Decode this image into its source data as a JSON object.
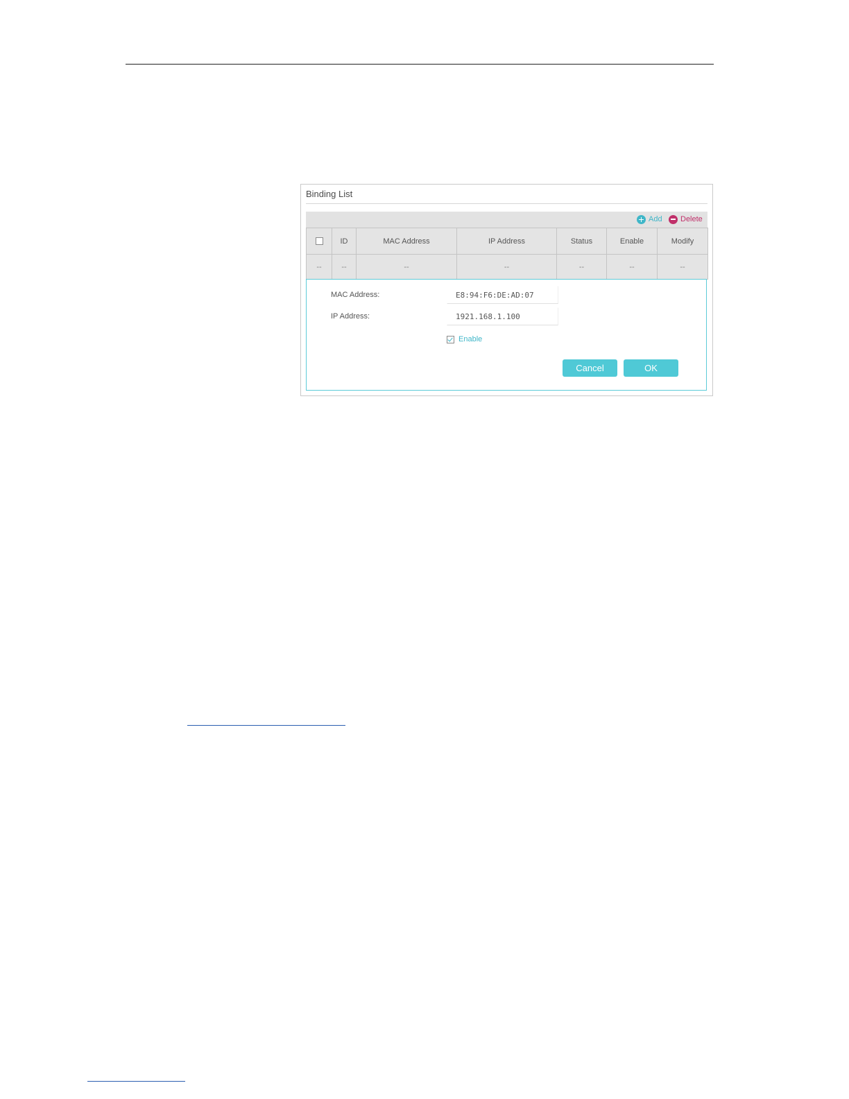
{
  "panel": {
    "title": "Binding List",
    "toolbar": {
      "add_label": "Add",
      "delete_label": "Delete"
    },
    "table": {
      "headers": [
        "ID",
        "MAC Address",
        "IP Address",
        "Status",
        "Enable",
        "Modify"
      ],
      "rows": [
        [
          "--",
          "--",
          "--",
          "--",
          "--",
          "--",
          "--"
        ]
      ]
    },
    "editor": {
      "mac_label": "MAC Address:",
      "mac_value": "E8:94:F6:DE:AD:07",
      "ip_label": "IP Address:",
      "ip_value": "1921.168.1.100",
      "enable_label": "Enable",
      "enable_checked": true,
      "cancel_label": "Cancel",
      "ok_label": "OK"
    }
  },
  "colors": {
    "accent": "#4fc9d6",
    "add": "#3fb6c8",
    "delete": "#c0306a",
    "table_bg": "#e4e4e4"
  }
}
